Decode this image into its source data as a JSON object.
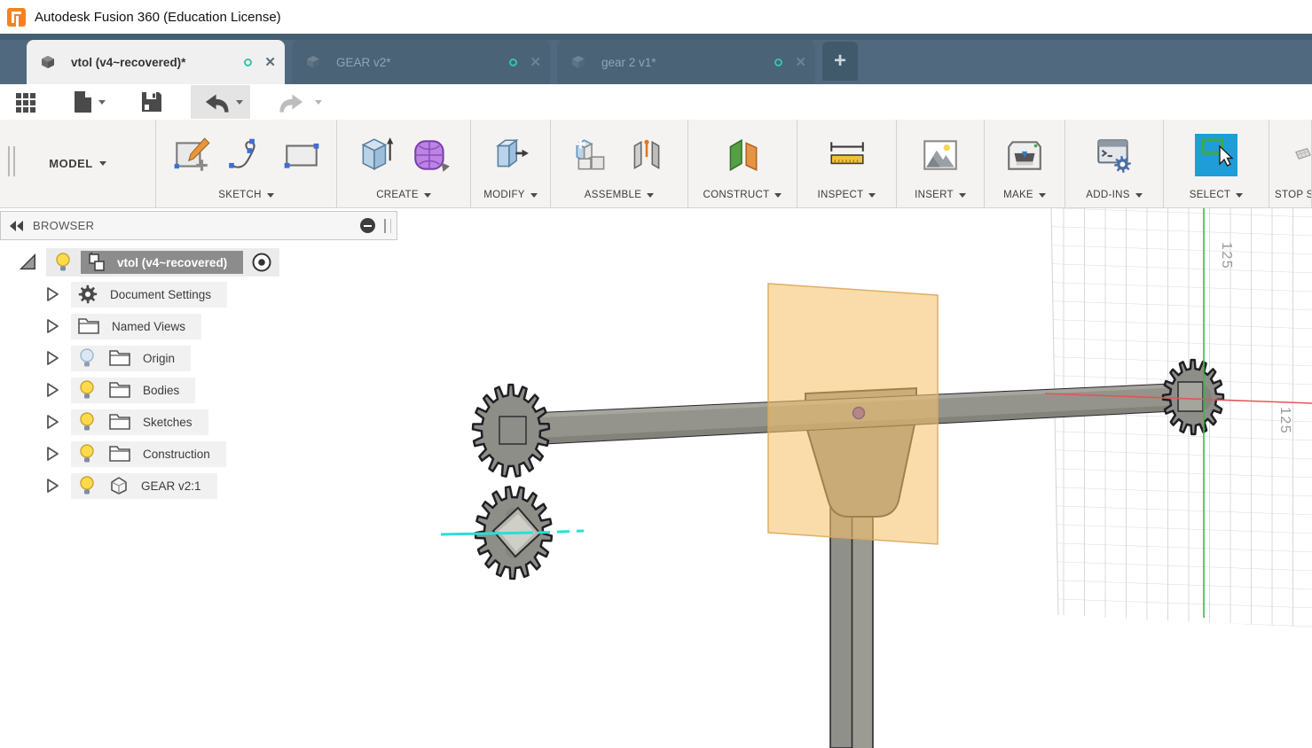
{
  "window": {
    "app_title": "Autodesk Fusion 360 (Education License)"
  },
  "tabstrip": {
    "tabs": [
      {
        "label": "vtol (v4~recovered)*",
        "state": "active"
      },
      {
        "label": "GEAR v2*",
        "state": "inactive"
      },
      {
        "label": "gear 2 v1*",
        "state": "inactive"
      }
    ],
    "new_tab_label": "+"
  },
  "quickbar": {
    "buttons": [
      "show-data-panel",
      "file",
      "save",
      "undo",
      "redo"
    ]
  },
  "ribbon": {
    "workspace": {
      "label": "MODEL"
    },
    "groups": [
      {
        "label": "SKETCH"
      },
      {
        "label": "CREATE"
      },
      {
        "label": "MODIFY"
      },
      {
        "label": "ASSEMBLE"
      },
      {
        "label": "CONSTRUCT"
      },
      {
        "label": "INSPECT"
      },
      {
        "label": "INSERT"
      },
      {
        "label": "MAKE"
      },
      {
        "label": "ADD-INS"
      },
      {
        "label": "SELECT"
      },
      {
        "label": "STOP S"
      }
    ]
  },
  "browser": {
    "title": "BROWSER",
    "root": {
      "label": "vtol (v4~recovered)"
    },
    "items": [
      {
        "label": "Document Settings",
        "icon": "gear",
        "bulb": "none"
      },
      {
        "label": "Named Views",
        "icon": "folder",
        "bulb": "none"
      },
      {
        "label": "Origin",
        "icon": "folder",
        "bulb": "off"
      },
      {
        "label": "Bodies",
        "icon": "folder",
        "bulb": "on"
      },
      {
        "label": "Sketches",
        "icon": "folder",
        "bulb": "on"
      },
      {
        "label": "Construction",
        "icon": "folder",
        "bulb": "on"
      },
      {
        "label": "GEAR v2:1",
        "icon": "cube",
        "bulb": "on"
      }
    ]
  },
  "viewport": {
    "grid_label_top": "125",
    "grid_label_right": "125"
  },
  "colors": {
    "tabstrip_bg": "#50697e",
    "select_active_bg": "#1f9dd9",
    "construction_plane": "#f5c36b",
    "cloud_status": "#39c2a7",
    "axis_green": "#3fb44b",
    "axis_red": "#e25555",
    "axis_cyan": "#27e0d6"
  }
}
